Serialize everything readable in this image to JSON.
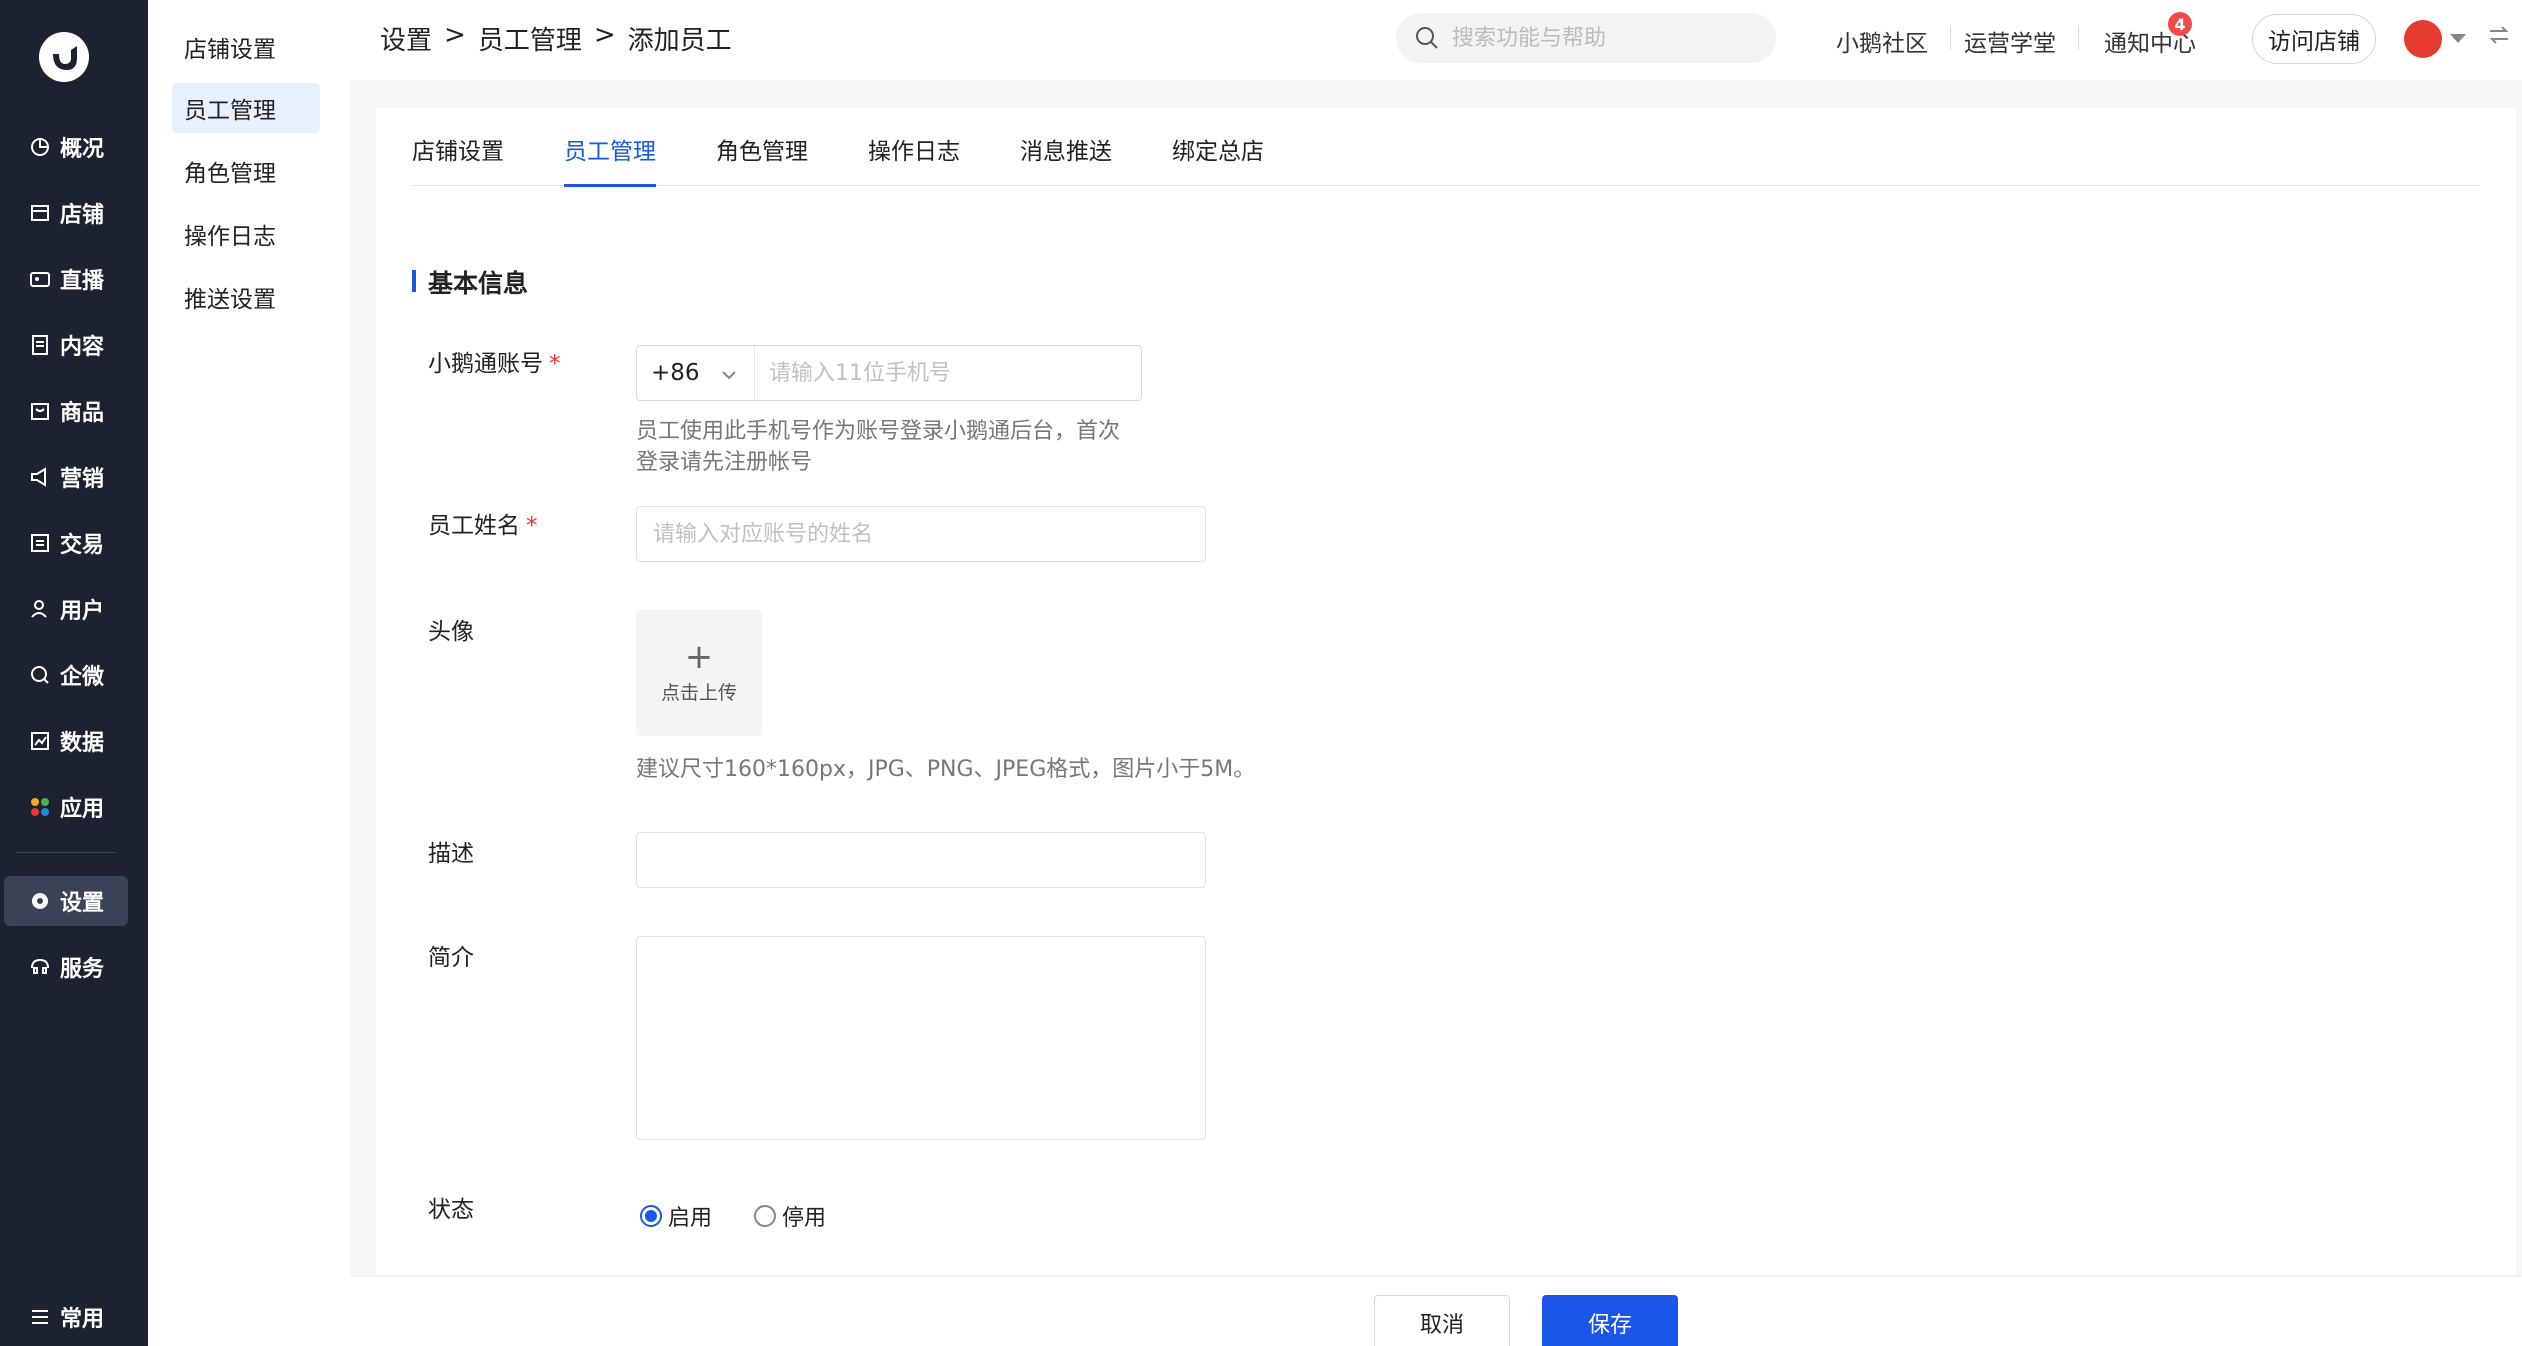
{
  "nav": {
    "items": [
      {
        "label": "概况",
        "icon": "overview-icon"
      },
      {
        "label": "店铺",
        "icon": "store-icon"
      },
      {
        "label": "直播",
        "icon": "live-icon"
      },
      {
        "label": "内容",
        "icon": "content-icon"
      },
      {
        "label": "商品",
        "icon": "goods-icon"
      },
      {
        "label": "营销",
        "icon": "marketing-icon"
      },
      {
        "label": "交易",
        "icon": "trade-icon"
      },
      {
        "label": "用户",
        "icon": "user-icon"
      },
      {
        "label": "企微",
        "icon": "wecom-icon"
      },
      {
        "label": "数据",
        "icon": "data-icon"
      },
      {
        "label": "应用",
        "icon": "apps-icon"
      },
      {
        "label": "设置",
        "icon": "gear-icon"
      },
      {
        "label": "服务",
        "icon": "service-icon"
      }
    ],
    "bottom": {
      "label": "常用",
      "icon": "list-icon"
    }
  },
  "subnav": {
    "items": [
      "店铺设置",
      "员工管理",
      "角色管理",
      "操作日志",
      "推送设置"
    ]
  },
  "header": {
    "breadcrumb": [
      "设置",
      ">",
      "员工管理",
      ">",
      "添加员工"
    ],
    "search_placeholder": "搜索功能与帮助",
    "links": [
      "小鹅社区",
      "运营学堂",
      "通知中心"
    ],
    "notify_count": "4",
    "visit_label": "访问店铺"
  },
  "tabs": [
    "店铺设置",
    "员工管理",
    "角色管理",
    "操作日志",
    "消息推送",
    "绑定总店"
  ],
  "form": {
    "section_title": "基本信息",
    "account_label": "小鹅通账号",
    "required_mark": "*",
    "country_code": "+86",
    "phone_placeholder": "请输入11位手机号",
    "account_hint_1": "员工使用此手机号作为账号登录小鹅通后台，首次",
    "account_hint_2": "登录请先注册帐号",
    "name_label": "员工姓名",
    "name_placeholder": "请输入对应账号的姓名",
    "avatar_label": "头像",
    "upload_plus": "+",
    "upload_text": "点击上传",
    "avatar_hint": "建议尺寸160*160px，JPG、PNG、JPEG格式，图片小于5M。",
    "desc_label": "描述",
    "intro_label": "简介",
    "status_label": "状态",
    "status_on": "启用",
    "status_off": "停用"
  },
  "footer": {
    "cancel": "取消",
    "save": "保存"
  },
  "colors": {
    "primary": "#1a56e8",
    "nav_bg": "#1d2230",
    "badge": "#f24949"
  }
}
